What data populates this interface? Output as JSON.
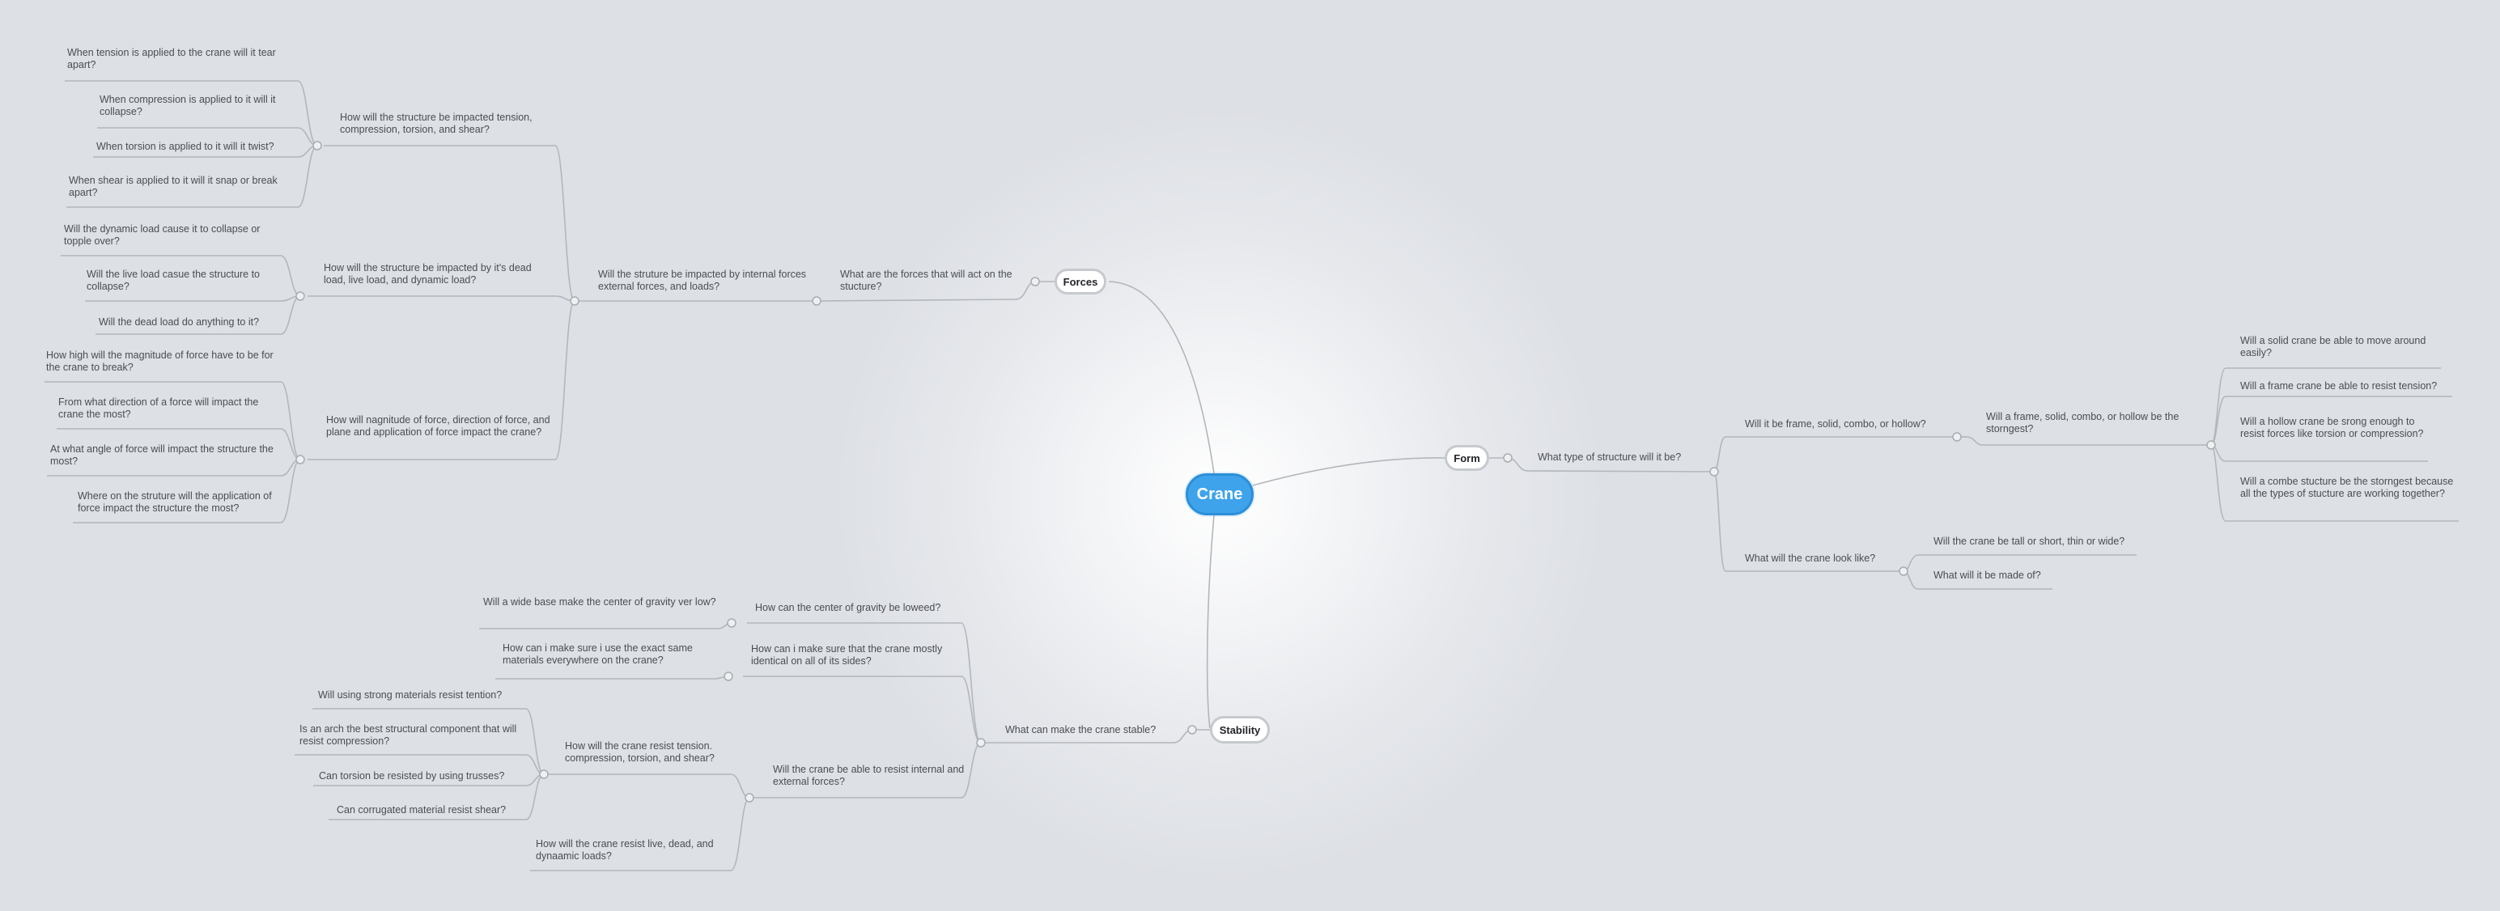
{
  "root": "Crane",
  "mains": {
    "forces": "Forces",
    "form": "Form",
    "stability": "Stability"
  },
  "forces": {
    "q1": "What are the forces that will act on the stucture?",
    "q2": "Will the struture be impacted by internal forces external forces, and loads?",
    "a": {
      "label": "How will the structure be impacted tension, compression, torsion, and shear?",
      "items": [
        "When tension is applied to the crane will it tear apart?",
        "When compression is applied to it will it collapse?",
        "When torsion is applied to it will it twist?",
        "When shear is applied to it will it snap or break apart?"
      ]
    },
    "b": {
      "label": "How will the structure be impacted by it's dead load, live load, and dynamic load?",
      "items": [
        "Will the dynamic load cause it to collapse or topple over?",
        "Will the live load casue the structure to collapse?",
        "Will the dead load do anything to it?"
      ]
    },
    "c": {
      "label": "How will nagnitude of force, direction of force, and plane and application of force impact the crane?",
      "items": [
        "How high will the magnitude of force have to be for the crane to break?",
        "From what direction of a force will impact the crane the most?",
        "At what angle of force will impact the structure the most?",
        "Where on the struture will the application of force impact the structure the most?"
      ]
    }
  },
  "form": {
    "q1": "What type of structure will it be?",
    "a": {
      "label": "Will it be frame, solid, combo, or hollow?",
      "sub": "Will a frame, solid, combo, or hollow be the storngest?",
      "items": [
        "Will a solid crane be able to move around easily?",
        "Will a frame crane be able to resist tension?",
        "Will a hollow crane be srong enough to resist forces like torsion or compression?",
        "Will a combe stucture be the storngest because all the types of stucture are working together?"
      ]
    },
    "b": {
      "label": "What will the crane look like?",
      "items": [
        "Will the crane be tall or short, thin or wide?",
        "What will it be made of?"
      ]
    }
  },
  "stability": {
    "q1": "What can make the crane stable?",
    "a": {
      "label": "How can the center of gravity be loweed?",
      "item": "Will a wide base make the center of gravity ver low?"
    },
    "b": {
      "label": "How can i make sure that the crane mostly identical on all of its sides?",
      "item": "How can i make sure i use the exact same materials everywhere on the crane?"
    },
    "c": {
      "label": "Will the crane be able to resist internal and external forces?",
      "sub1": {
        "label": "How will the crane resist tension. compression, torsion, and shear?",
        "items": [
          "Will using strong materials resist tention?",
          "Is an arch the best structural component that will resist compression?",
          "Can torsion be resisted by using trusses?",
          "Can corrugated material resist shear?"
        ]
      },
      "sub2": "How will the crane resist live, dead, and dynaamic loads?"
    }
  }
}
